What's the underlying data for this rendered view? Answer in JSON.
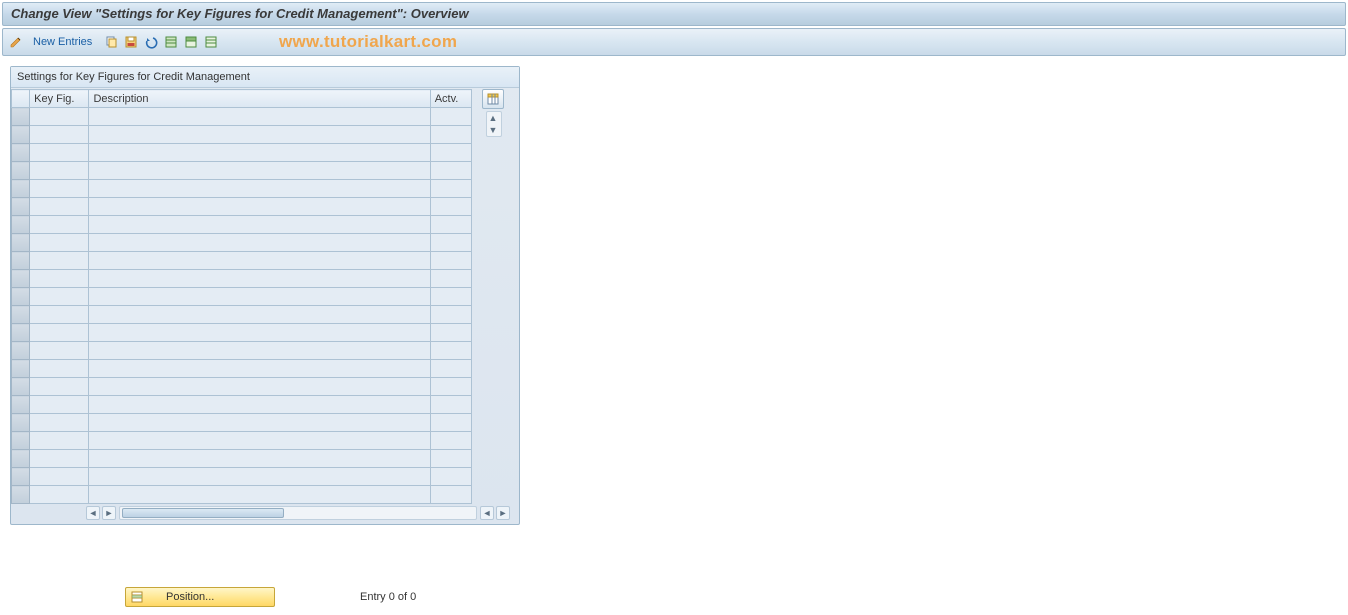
{
  "title": "Change View \"Settings for Key Figures for Credit Management\": Overview",
  "toolbar": {
    "new_entries_label": "New Entries",
    "icons": {
      "edit": "edit-pencil-icon",
      "copy": "copy-icon",
      "save_var": "save-variant-icon",
      "undo": "undo-icon",
      "select_all": "select-all-icon",
      "select_block": "select-block-icon",
      "deselect_all": "deselect-all-icon"
    }
  },
  "watermark": "www.tutorialkart.com",
  "table": {
    "caption": "Settings for Key Figures for Credit Management",
    "columns": {
      "key_fig": "Key Fig.",
      "description": "Description",
      "actv": "Actv."
    },
    "row_count": 22,
    "rows": []
  },
  "scroll": {
    "config_icon": "table-settings-icon"
  },
  "footer": {
    "position_label": "Position...",
    "entry_label": "Entry 0 of 0"
  }
}
